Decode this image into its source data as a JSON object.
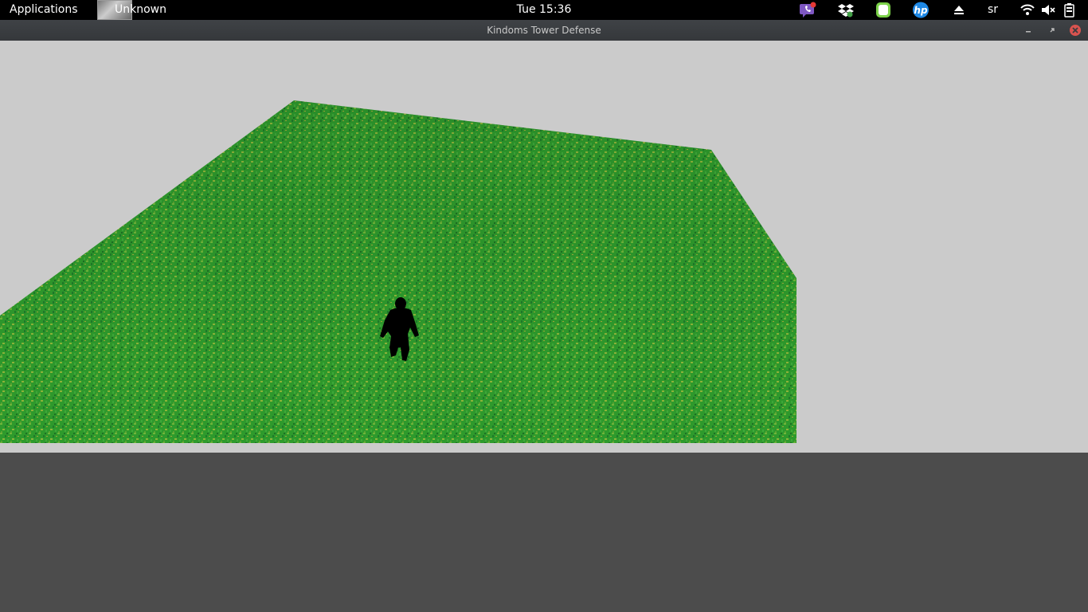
{
  "topbar": {
    "applications_label": "Applications",
    "active_app_label": "Unknown",
    "clock": "Tue 15:36",
    "user_label": "sr",
    "tray_icons": [
      "viber-icon",
      "dropbox-icon",
      "evernote-icon",
      "hp-icon",
      "eject-icon",
      "wifi-icon",
      "volume-muted-icon",
      "battery-icon"
    ]
  },
  "window": {
    "title": "Kindoms Tower Defense",
    "buttons": [
      "minimize-icon",
      "restore-icon",
      "close-icon"
    ]
  },
  "scene": {
    "ground_color": "#2f9a2a",
    "sky_color": "#cbcbcb",
    "character": "dark humanoid figure"
  },
  "colors": {
    "topbar": "#000000",
    "titlebar": "#3a3d40",
    "desktop": "#4c4c4c",
    "close_button": "#d9534f"
  }
}
